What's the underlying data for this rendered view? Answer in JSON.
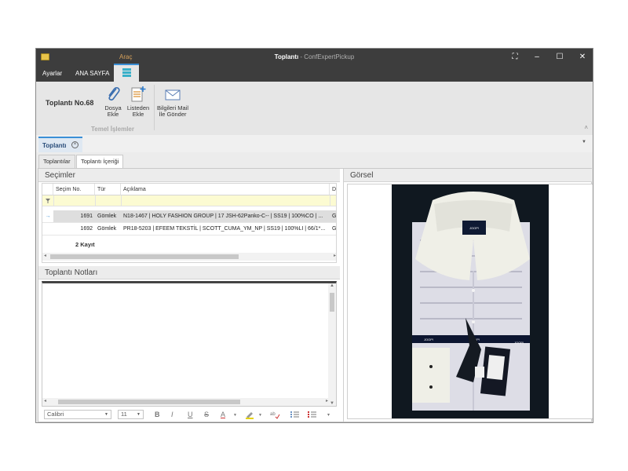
{
  "window": {
    "context_tab": "Araç",
    "title_main": "Toplantı",
    "title_sub": " - ConfExpertPickup",
    "controls": [
      "⛶",
      "–",
      "☐",
      "✕"
    ]
  },
  "menu": {
    "items": [
      "Ayarlar",
      "ANA SAYFA"
    ]
  },
  "ribbon": {
    "meeting_no": "Toplantı No.68",
    "buttons": [
      {
        "line1": "Dosya",
        "line2": "Ekle",
        "icon": "paperclip-icon"
      },
      {
        "line1": "Listeden",
        "line2": "Ekle",
        "icon": "list-add-icon"
      },
      {
        "line1": "Bilgileri Mail",
        "line2": "İle Gönder",
        "icon": "mail-icon"
      }
    ],
    "group_label": "Temel İşlemler",
    "collapse_glyph": "˄"
  },
  "doc_tab": {
    "label": "Toplantı",
    "close": "×"
  },
  "sub_tabs": [
    "Toplantılar",
    "Toplantı İçeriği"
  ],
  "selections": {
    "title": "Seçimler",
    "columns": [
      "Seçim No.",
      "Tür",
      "Açıklama",
      "D"
    ],
    "rows": [
      {
        "no": "1691",
        "type": "Gömlek",
        "desc": "N18-1467 | HOLY FASHION GROUP | 17 JSH-62Panko-C-- | SS19 | 100%CO | ...",
        "extra": "G",
        "current": true
      },
      {
        "no": "1692",
        "type": "Gömlek",
        "desc": "PR18-5203 | EFEEM TEKSTİL | SCOTT_CUMA_YM_NP | SS19 | 100%LI | 66/1*...",
        "extra": "G",
        "current": false
      }
    ],
    "record_count": "2 Kayıt"
  },
  "notes": {
    "title": "Toplantı Notları",
    "font": "Calibri",
    "size": "11",
    "format_buttons": [
      "B",
      "I",
      "U",
      "S",
      "A"
    ]
  },
  "image_panel": {
    "title": "Görsel",
    "brand": "JOOP!"
  },
  "colors": {
    "titlebar": "#3d3d3d",
    "accent": "#3a8fd6",
    "context": "#d7a15b",
    "filter_row": "#fcfbd2"
  }
}
